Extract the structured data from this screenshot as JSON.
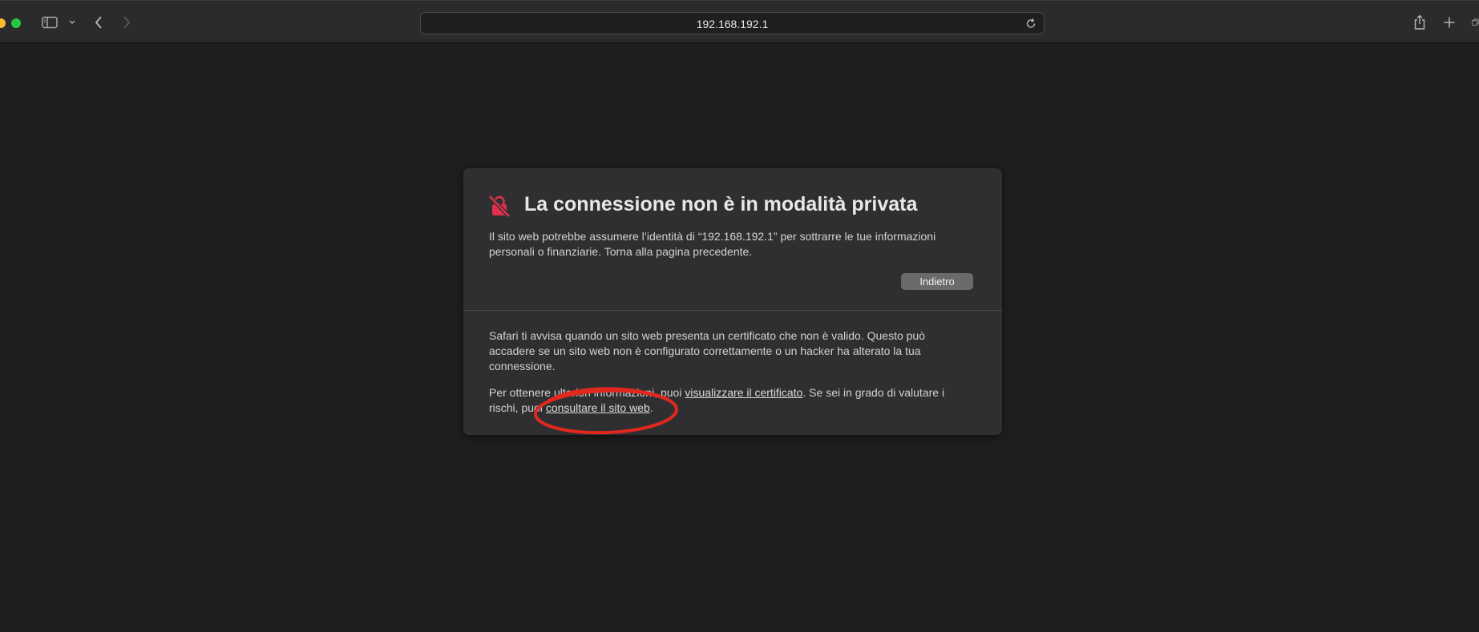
{
  "browser": {
    "address": "192.168.192.1",
    "icons": {
      "sidebar": "sidebar-icon",
      "sidebar_menu": "chevron-down-icon",
      "back": "chevron-left-icon",
      "forward": "chevron-right-icon",
      "reload": "reload-icon",
      "share": "share-icon",
      "new_tab": "plus-icon",
      "tabs": "tab-overview-icon"
    }
  },
  "warning": {
    "icon": "lock-slash-icon",
    "icon_color": "#e0314b",
    "title": "La connessione non è in modalità privata",
    "message_line1": "Il sito web potrebbe assumere l’identità di “192.168.192.1” per sottrarre le tue informazioni",
    "message_line2": "personali o finanziarie. Torna alla pagina precedente.",
    "back_button": "Indietro",
    "info_line1": "Safari ti avvisa quando un sito web presenta un certificato che non è valido. Questo può",
    "info_line2": "accadere se un sito web non è configurato correttamente o un hacker ha alterato la tua",
    "info_line3": "connessione.",
    "more_prefix": "Per ottenere ulteriori informazioni, puoi ",
    "view_certificate_link": "visualizzare il certificato",
    "more_middle1": ". Se sei in grado di valutare i",
    "more_middle2": "rischi, puoi ",
    "visit_site_link": "consultare il sito web",
    "more_suffix": "."
  },
  "annotation": {
    "shape": "ellipse",
    "color": "#e0281e"
  }
}
